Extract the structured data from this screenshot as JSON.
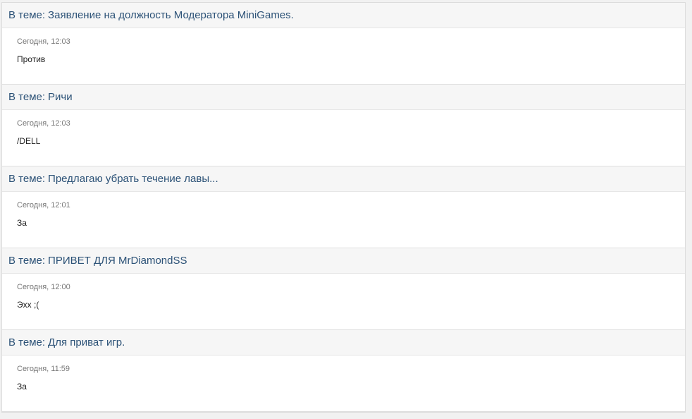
{
  "prefix": "В теме:",
  "posts": [
    {
      "topic": "Заявление на должность Модератора MiniGames.",
      "time": "Сегодня, 12:03",
      "text": "Против"
    },
    {
      "topic": "Ричи",
      "time": "Сегодня, 12:03",
      "text": "/DELL"
    },
    {
      "topic": "Предлагаю убрать течение лавы...",
      "time": "Сегодня, 12:01",
      "text": "За"
    },
    {
      "topic": "ПРИВЕТ ДЛЯ MrDiamondSS",
      "time": "Сегодня, 12:00",
      "text": "Эхх ;("
    },
    {
      "topic": "Для приват игр.",
      "time": "Сегодня, 11:59",
      "text": "За"
    }
  ],
  "colors": {
    "link": "#2c5277",
    "header_bg": "#f6f6f6",
    "page_bg": "#f1f1f1"
  }
}
